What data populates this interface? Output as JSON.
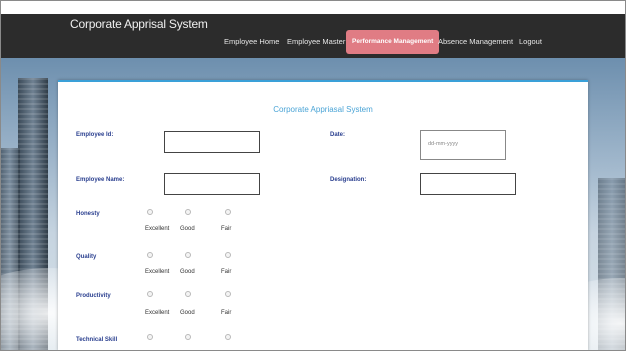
{
  "app": {
    "title": "Corporate Apprisal System"
  },
  "nav": {
    "items": [
      {
        "label": "Employee Home",
        "active": false
      },
      {
        "label": "Employee Master",
        "active": false
      },
      {
        "label": "Performance Management",
        "active": true
      },
      {
        "label": "Absence Management",
        "active": false
      },
      {
        "label": "Logout",
        "active": false
      }
    ]
  },
  "form": {
    "title": "Corporate Appriasal System",
    "employee_id_label": "Employee Id:",
    "employee_id_value": "",
    "date_label": "Date:",
    "date_placeholder": "dd-mm-yyyy",
    "employee_name_label": "Employee Name:",
    "employee_name_value": "",
    "designation_label": "Designation:",
    "designation_value": "",
    "ratings": [
      {
        "label": "Honesty"
      },
      {
        "label": "Quality"
      },
      {
        "label": "Productivity"
      },
      {
        "label": "Technical Skill"
      }
    ],
    "options": [
      "Excellent",
      "Good",
      "Fair"
    ]
  },
  "colors": {
    "nav_bar": "#2c2c2c",
    "active_tab": "#e07c84",
    "label_blue": "#2a3f8f",
    "title_blue": "#4aa4d6",
    "accent": "#3aa0d8"
  }
}
